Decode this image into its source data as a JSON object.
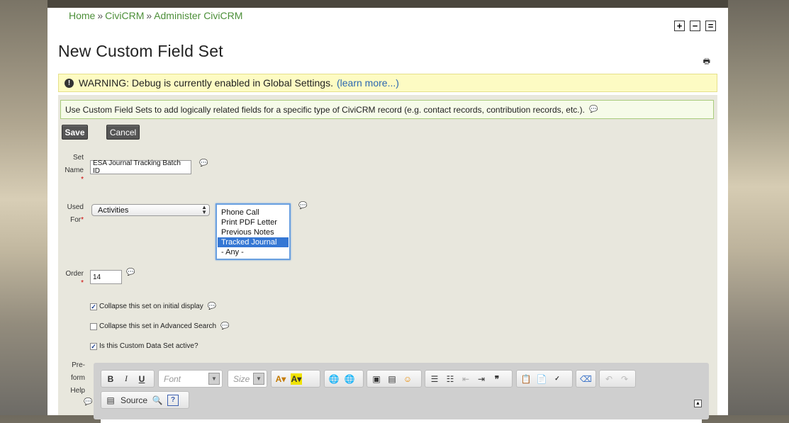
{
  "breadcrumb": {
    "items": [
      "Home",
      "CiviCRM",
      "Administer CiviCRM"
    ],
    "separator": "»"
  },
  "font_controls": {
    "increase": "+",
    "decrease": "−",
    "reset": "="
  },
  "page_title": "New Custom Field Set",
  "warning": {
    "text": "WARNING: Debug is currently enabled in Global Settings.",
    "link": "(learn more...)"
  },
  "help_text": "Use Custom Field Sets to add logically related fields for a specific type of CiviCRM record (e.g. contact records, contribution records, etc.).",
  "buttons": {
    "save": "Save",
    "cancel": "Cancel"
  },
  "form": {
    "set_name": {
      "label_line1": "Set",
      "label_line2": "Name",
      "value": "ESA Journal Tracking Batch ID"
    },
    "used_for": {
      "label_line1": "Used",
      "label_line2": "For",
      "selected": "Activities",
      "options": [
        "Phone Call",
        "Print PDF Letter",
        "Previous Notes",
        "Tracked Journal",
        "- Any -"
      ],
      "highlighted": "Tracked Journal"
    },
    "order": {
      "label": "Order",
      "value": "14"
    },
    "checkboxes": [
      {
        "label": "Collapse this set on initial display",
        "checked": true
      },
      {
        "label": "Collapse this set in Advanced Search",
        "checked": false
      },
      {
        "label": "Is this Custom Data Set active?",
        "checked": true
      }
    ],
    "preform_help": {
      "label_line1": "Pre-",
      "label_line2": "form",
      "label_line3": "Help"
    }
  },
  "editor_toolbar": {
    "font_placeholder": "Font",
    "size_placeholder": "Size",
    "source_label": "Source"
  },
  "colors": {
    "link": "#4c8f39",
    "warning_bg": "#fdfbc3",
    "help_bg": "#f6fbe9",
    "selected_option": "#3577d4"
  }
}
